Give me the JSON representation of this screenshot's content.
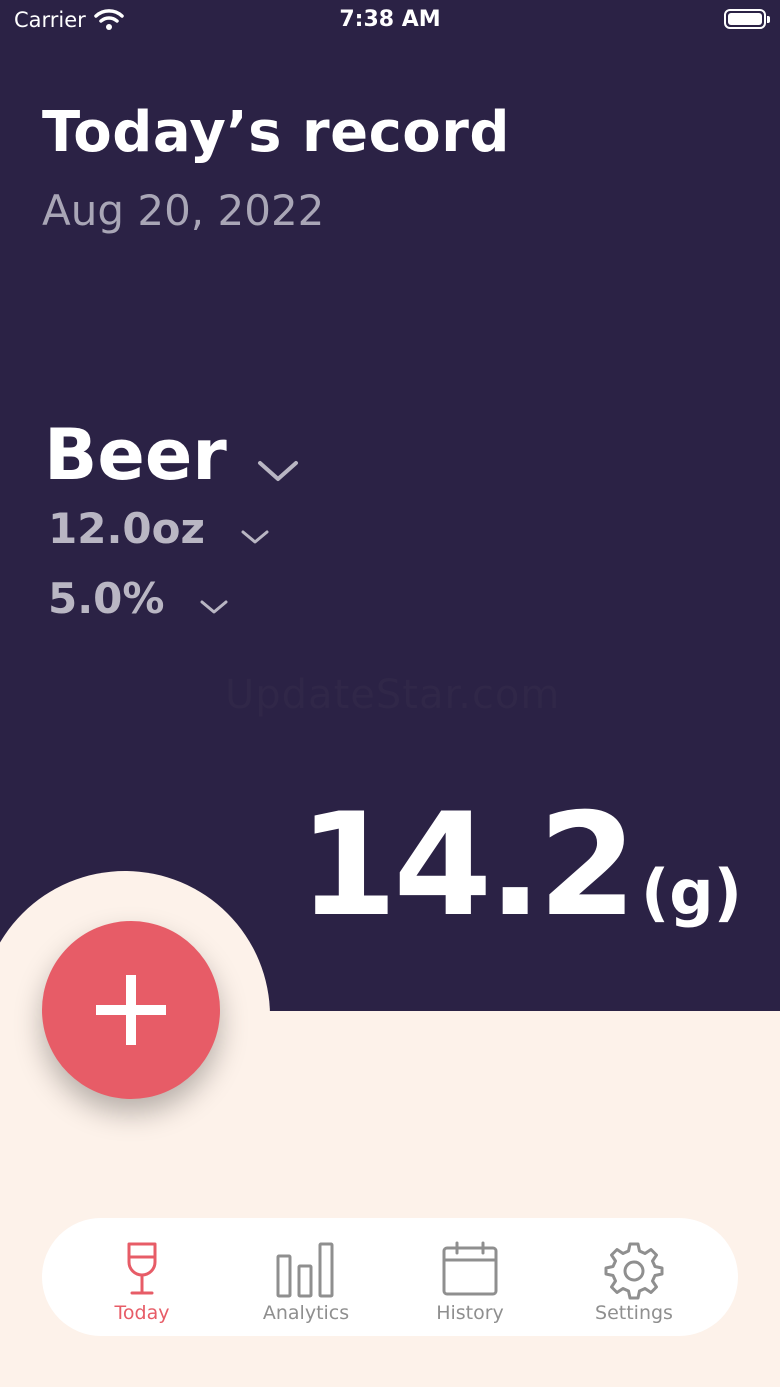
{
  "status_bar": {
    "carrier": "Carrier",
    "time": "7:38 AM"
  },
  "header": {
    "title": "Today’s record",
    "date": "Aug 20, 2022"
  },
  "drink": {
    "type": "Beer",
    "size": "12.0oz",
    "abv": "5.0%"
  },
  "watermark": "UpdateStar.com",
  "total": {
    "value": "14.2",
    "unit": "(g)"
  },
  "tabs": [
    {
      "label": "Today",
      "icon": "wine-glass-icon"
    },
    {
      "label": "Analytics",
      "icon": "bar-chart-icon"
    },
    {
      "label": "History",
      "icon": "calendar-icon"
    },
    {
      "label": "Settings",
      "icon": "gear-icon"
    }
  ],
  "colors": {
    "header_bg": "#2b2245",
    "page_bg": "#fdf2ea",
    "accent": "#e75c67"
  }
}
